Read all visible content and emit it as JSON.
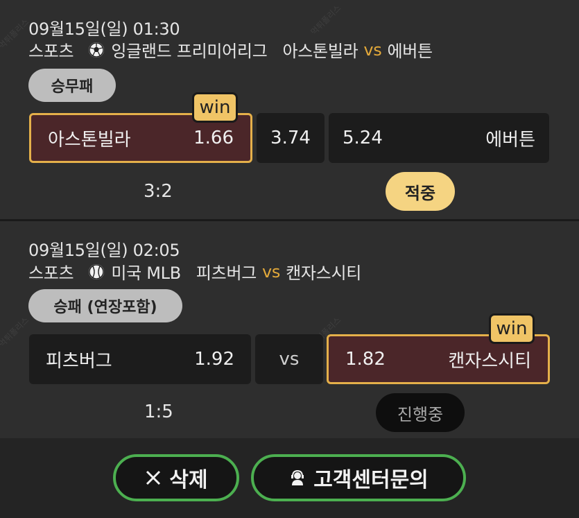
{
  "watermark": "먹튀폴리스",
  "match1": {
    "datetime": "09월15일(일) 01:30",
    "sport": "스포츠",
    "league_icon": "soccer-ball-icon",
    "league": "잉글랜드 프리미어리그",
    "home": "아스톤빌라",
    "vs": "vs",
    "away": "에버튼",
    "market": "승무패",
    "win_label": "win",
    "home_odds": "1.66",
    "draw_odds": "3.74",
    "away_odds": "5.24",
    "score": "3:2",
    "status": "적중"
  },
  "match2": {
    "datetime": "09월15일(일) 02:05",
    "sport": "스포츠",
    "league_icon": "baseball-icon",
    "league": "미국 MLB",
    "home": "피츠버그",
    "vs": "vs",
    "away": "캔자스시티",
    "market": "승패 (연장포함)",
    "win_label": "win",
    "home_odds": "1.92",
    "center_label": "vs",
    "away_odds": "1.82",
    "score": "1:5",
    "status": "진행중"
  },
  "footer": {
    "delete_label": "삭제",
    "support_label": "고객센터문의"
  },
  "colors": {
    "accent_gold": "#e5b04a",
    "win_bg": "#4b2629",
    "button_border": "#4caf50"
  }
}
